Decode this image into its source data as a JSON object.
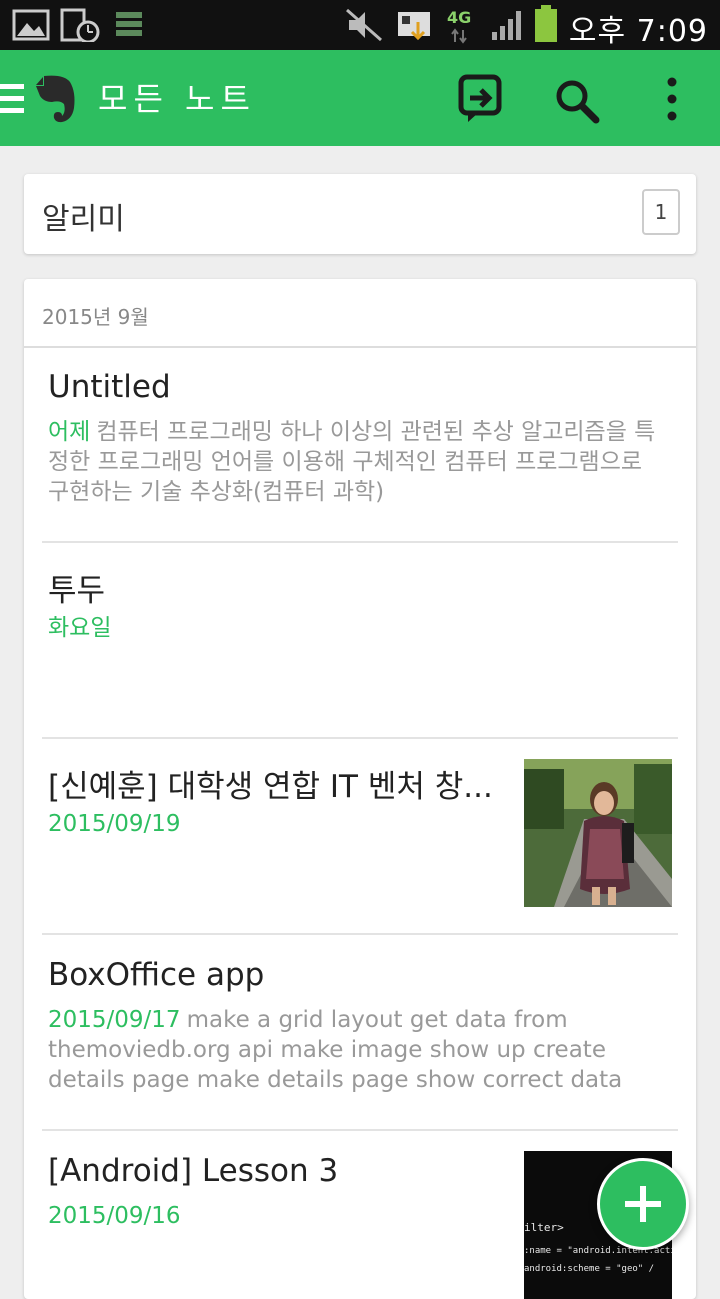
{
  "status_bar": {
    "network": "4G",
    "time": "오후 7:09"
  },
  "app_bar": {
    "title": "모든 노트",
    "icons": [
      "menu-icon",
      "evernote-logo",
      "sync-icon",
      "search-icon",
      "overflow-icon"
    ]
  },
  "reminders": {
    "label": "알리미",
    "count": "1"
  },
  "notes_section": {
    "month_header": "2015년 9월",
    "notes": [
      {
        "title": "Untitled",
        "date": "어제",
        "snippet": "컴퓨터 프로그래밍   하나 이상의 관련된 추상 알고리즘을 특정한 프로그래밍 언어를 이용해 구체적인 컴퓨터 프로그램으로 구현하는 기술       추상화(컴퓨터 과학)"
      },
      {
        "title": "투두",
        "date": "화요일",
        "snippet": ""
      },
      {
        "title": "[신예훈] 대학생 연합 IT 벤처 창...",
        "date": "2015/09/19",
        "snippet": "",
        "thumbnail": "photo-person-park"
      },
      {
        "title": "BoxOffice app",
        "date": "2015/09/17",
        "snippet": "make a grid layout   get data from themoviedb.org api   make image show up   create details page   make details page show correct data"
      },
      {
        "title": "[Android] Lesson 3",
        "date": "2015/09/16",
        "snippet": "",
        "thumbnail": "code-screenshot",
        "thumbnail_text": [
          "ilter>",
          ":name = \"android.intent.actio",
          "android:scheme = \"geo\" /"
        ]
      }
    ]
  },
  "fab": {
    "icon": "plus-icon"
  },
  "colors": {
    "accent": "#2dbe60",
    "status_bar": "#111111",
    "background": "#eeeeee"
  }
}
